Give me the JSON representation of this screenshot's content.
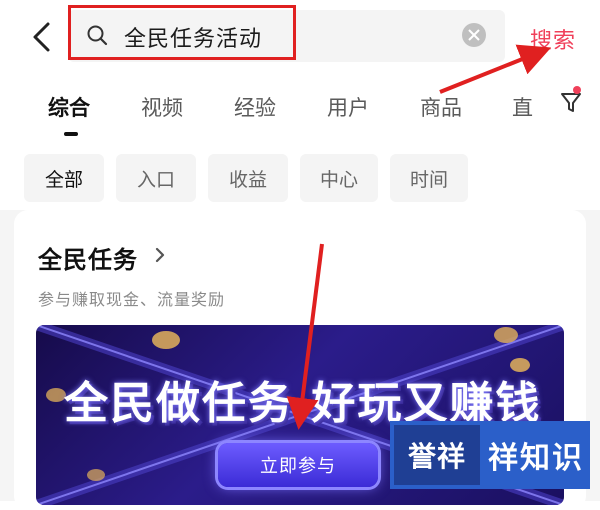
{
  "header": {
    "back_icon": "chevron-left-icon",
    "search_query": "全民任务活动",
    "search_icon": "magnifier-icon",
    "clear_icon": "clear-circle-icon",
    "search_button": "搜索"
  },
  "tabs": [
    {
      "label": "综合",
      "active": true
    },
    {
      "label": "视频",
      "active": false
    },
    {
      "label": "经验",
      "active": false
    },
    {
      "label": "用户",
      "active": false
    },
    {
      "label": "商品",
      "active": false
    },
    {
      "label": "直",
      "active": false
    }
  ],
  "filter_icon": "filter-funnel-icon",
  "chips": [
    {
      "label": "全部",
      "active": true
    },
    {
      "label": "入口",
      "active": false
    },
    {
      "label": "收益",
      "active": false
    },
    {
      "label": "中心",
      "active": false
    },
    {
      "label": "时间",
      "active": false
    }
  ],
  "card": {
    "title": "全民任务",
    "subtitle": "参与赚取现金、流量奖励",
    "banner_title": "全民做任务 好玩又赚钱",
    "join_button": "立即参与"
  },
  "watermark": {
    "badge": "誉祥",
    "text": "祥知识"
  },
  "colors": {
    "accent": "#f0405a",
    "annotation_red": "#e02020",
    "banner_purple": "#2b1c8a",
    "watermark_blue": "#2b5fc9"
  }
}
